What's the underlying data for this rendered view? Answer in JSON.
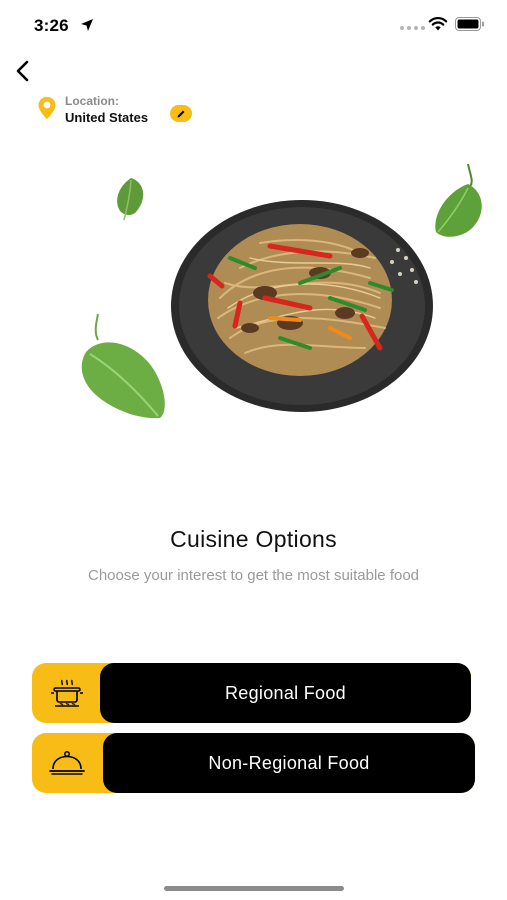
{
  "status_bar": {
    "time": "3:26",
    "icons": [
      "location-arrow-icon",
      "signal-dots-icon",
      "wifi-icon",
      "battery-icon"
    ]
  },
  "header": {
    "back_icon": "chevron-left-icon",
    "location_label": "Location:",
    "location_value": "United States",
    "edit_icon": "pencil-icon"
  },
  "hero": {
    "image": "stir-fried-noodles-plate",
    "decorations": [
      "leaf",
      "leaf",
      "leaf"
    ]
  },
  "content": {
    "title": "Cuisine Options",
    "subtitle": "Choose your interest to get the most suitable food"
  },
  "options": [
    {
      "label": "Regional Food",
      "icon": "cooking-pot-icon"
    },
    {
      "label": "Non-Regional Food",
      "icon": "food-cloche-icon"
    }
  ],
  "colors": {
    "accent": "#f7bd16",
    "button_bg": "#000000",
    "button_text": "#ffffff",
    "subtitle": "#9a9a9a"
  }
}
